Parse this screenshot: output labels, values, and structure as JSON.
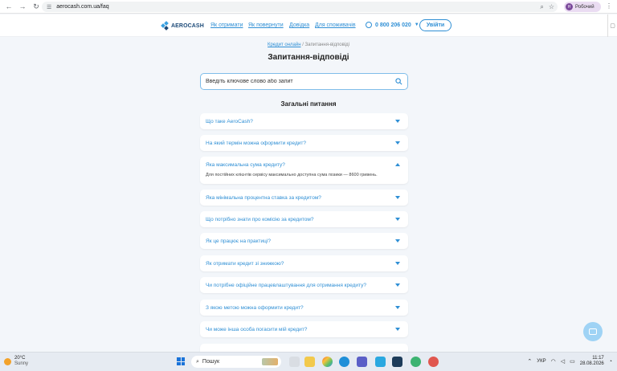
{
  "browser": {
    "url": "aerocash.com.ua/faq",
    "profile_initial": "Н",
    "profile_label": "Робочий"
  },
  "header": {
    "logo_text": "AEROCASH",
    "nav": [
      "Як отримати",
      "Як повернути",
      "Довідка",
      "Для споживачів"
    ],
    "phone": "0 800 206 020",
    "login_label": "Увійти"
  },
  "breadcrumb": {
    "link": "Кредит онлайн",
    "separator": "/",
    "current": "Запитання-відповіді"
  },
  "page_title": "Запитання-відповіді",
  "search": {
    "placeholder": "Введіть ключове слово або запит"
  },
  "section_title": "Загальні питання",
  "faq": [
    {
      "question": "Що таке AeroCash?",
      "expanded": false
    },
    {
      "question": "На який термін можна оформити кредит?",
      "expanded": false
    },
    {
      "question": "Яка максимальна сума кредиту?",
      "expanded": true,
      "answer": "Для постійних клієнтів сервісу максимально доступна сума позики — 8600 гривень."
    },
    {
      "question": "Яка мінімальна процентна ставка за кредитом?",
      "expanded": false
    },
    {
      "question": "Що потрібно знати про комісію за кредитом?",
      "expanded": false
    },
    {
      "question": "Як це працює на практиці?",
      "expanded": false
    },
    {
      "question": "Як отримати кредит зі знижкою?",
      "expanded": false
    },
    {
      "question": "Чи потрібне офіційне працевлаштування для отримання кредиту?",
      "expanded": false
    },
    {
      "question": "З якою метою можна оформити кредит?",
      "expanded": false
    },
    {
      "question": "Чи може інша особа погасити мій кредит?",
      "expanded": false
    }
  ],
  "taskbar": {
    "weather_temp": "20°C",
    "weather_desc": "Sunny",
    "search_label": "Пошук",
    "lang": "УКР",
    "time": "11:17",
    "date": "28.08.2026"
  }
}
